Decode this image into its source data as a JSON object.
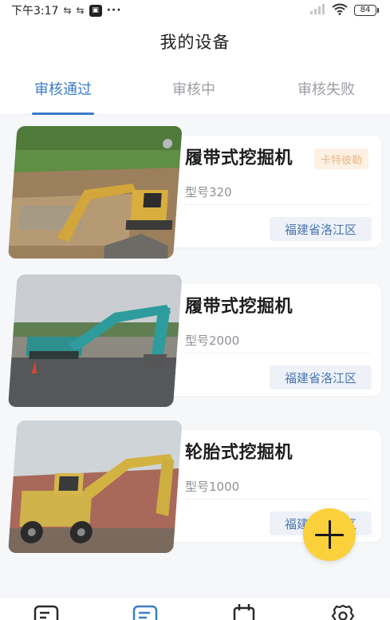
{
  "status_bar": {
    "time": "下午3:17",
    "battery": "84",
    "icons": [
      "usb-icon",
      "usb-icon",
      "notification-box-icon",
      "more-dots-icon",
      "signal-icon",
      "wifi-icon",
      "battery-icon"
    ]
  },
  "header": {
    "title": "我的设备"
  },
  "tabs": [
    {
      "label": "审核通过",
      "active": true
    },
    {
      "label": "审核中",
      "active": false
    },
    {
      "label": "审核失败",
      "active": false
    }
  ],
  "colors": {
    "accent": "#3c7cc9",
    "fab": "#fad13a",
    "region_text": "#4a76b0",
    "brand_tag_text": "#e9b78a"
  },
  "devices": [
    {
      "title": "履带式挖掘机",
      "brand": "卡特彼勒",
      "model": "型号320",
      "region": "福建省洛江区"
    },
    {
      "title": "履带式挖掘机",
      "brand": "",
      "model": "型号2000",
      "region": "福建省洛江区"
    },
    {
      "title": "轮胎式挖掘机",
      "brand": "",
      "model": "型号1000",
      "region": "福建省洛江区"
    }
  ],
  "fab": {
    "icon": "plus-icon"
  },
  "bottom_nav": [
    {
      "icon": "list-icon",
      "active": false
    },
    {
      "icon": "device-list-icon",
      "active": true
    },
    {
      "icon": "calendar-icon",
      "active": false
    },
    {
      "icon": "settings-gear-icon",
      "active": false
    }
  ]
}
